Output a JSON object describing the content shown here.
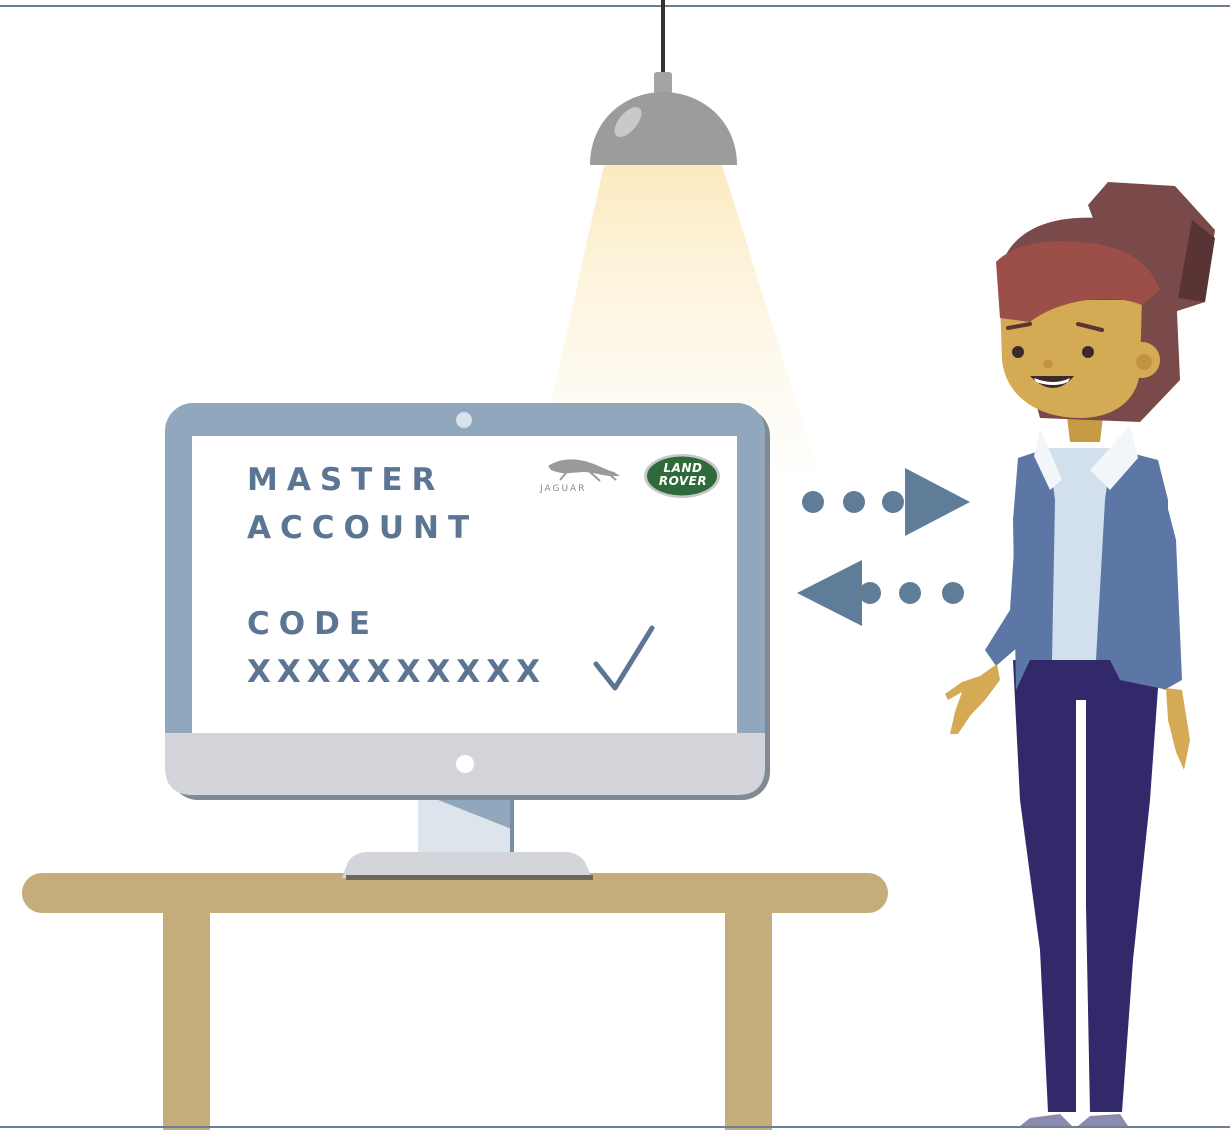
{
  "screen": {
    "title_line1": "MASTER",
    "title_line2": "ACCOUNT",
    "code_label": "CODE",
    "code_value": "XXXXXXXXXX",
    "status_icon": "check-icon"
  },
  "logos": {
    "jaguar": {
      "text": "JAGUAR",
      "icon": "jaguar-leaper-icon"
    },
    "land_rover": {
      "line1": "LAND",
      "line2": "ROVER"
    }
  },
  "arrows": {
    "outgoing": {
      "icon": "dotted-arrow-right-icon"
    },
    "incoming": {
      "icon": "dotted-arrow-left-icon"
    }
  },
  "colors": {
    "monitor_frame": "#91a7bd",
    "monitor_chin": "#d4d5da",
    "screen_text": "#5b7593",
    "arrow": "#5f7d99",
    "desk": "#c4ac7b",
    "land_rover_green": "#2f6b3a",
    "lamp": "#9c9c9c",
    "light_glow": "#fdf2d3"
  }
}
